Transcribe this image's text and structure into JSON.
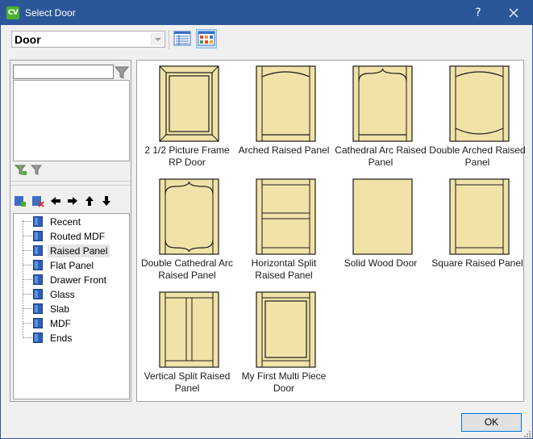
{
  "window": {
    "title": "Select Door",
    "app_icon_text": "CV",
    "help_label": "?",
    "close_label": "✕"
  },
  "toolbar": {
    "type_value": "Door"
  },
  "tree": {
    "items": [
      {
        "label": "Recent"
      },
      {
        "label": "Routed MDF"
      },
      {
        "label": "Raised Panel",
        "selected": true
      },
      {
        "label": "Flat Panel"
      },
      {
        "label": "Drawer Front"
      },
      {
        "label": "Glass"
      },
      {
        "label": "Slab"
      },
      {
        "label": "MDF"
      },
      {
        "label": "Ends"
      }
    ]
  },
  "gallery": {
    "doors": [
      {
        "label": "2 1/2 Picture Frame RP Door",
        "style": "picture-frame"
      },
      {
        "label": "Arched Raised Panel",
        "style": "arched"
      },
      {
        "label": "Cathedral Arc Raised Panel",
        "style": "cathedral"
      },
      {
        "label": "Double Arched Raised Panel",
        "style": "double-arched"
      },
      {
        "label": "Double Cathedral Arc Raised Panel",
        "style": "double-cathedral"
      },
      {
        "label": "Horizontal Split Raised Panel",
        "style": "horizontal-split"
      },
      {
        "label": "Solid Wood Door",
        "style": "solid"
      },
      {
        "label": "Square Raised Panel",
        "style": "square"
      },
      {
        "label": "Vertical Split Raised Panel",
        "style": "vertical-split"
      },
      {
        "label": "My First Multi Piece Door",
        "style": "multi-piece"
      }
    ]
  },
  "footer": {
    "ok_label": "OK"
  },
  "colors": {
    "titlebar": "#2b579a",
    "door_fill": "#f1e3a8",
    "door_stroke": "#1a1a1a",
    "accent": "#0078d7"
  }
}
